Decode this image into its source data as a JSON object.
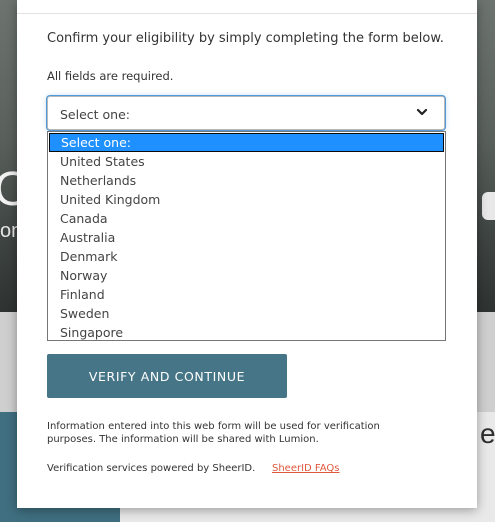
{
  "background": {
    "big_letter": "O",
    "letters_on": "on",
    "letter_e": "e"
  },
  "form": {
    "intro_text": "Confirm your eligibility by simply completing the form below.",
    "required_text": "All fields are required.",
    "country_select": {
      "value": "Select one:",
      "icon": "chevron-down-icon",
      "options": [
        "Select one:",
        "United States",
        "Netherlands",
        "United Kingdom",
        "Canada",
        "Australia",
        "Denmark",
        "Norway",
        "Finland",
        "Sweden",
        "Singapore"
      ],
      "highlighted_index": 0
    },
    "verify_button_label": "VERIFY AND CONTINUE",
    "info_text": "Information entered into this web form will be used for verification purposes. The information will be shared with Lumion.",
    "powered_text": "Verification services powered by SheerID.",
    "faq_link": "SheerID FAQs"
  },
  "colors": {
    "button_bg": "#457586",
    "highlight_bg": "#1e90ff",
    "link": "#e0583e",
    "focus_ring": "#4f9bd9"
  }
}
